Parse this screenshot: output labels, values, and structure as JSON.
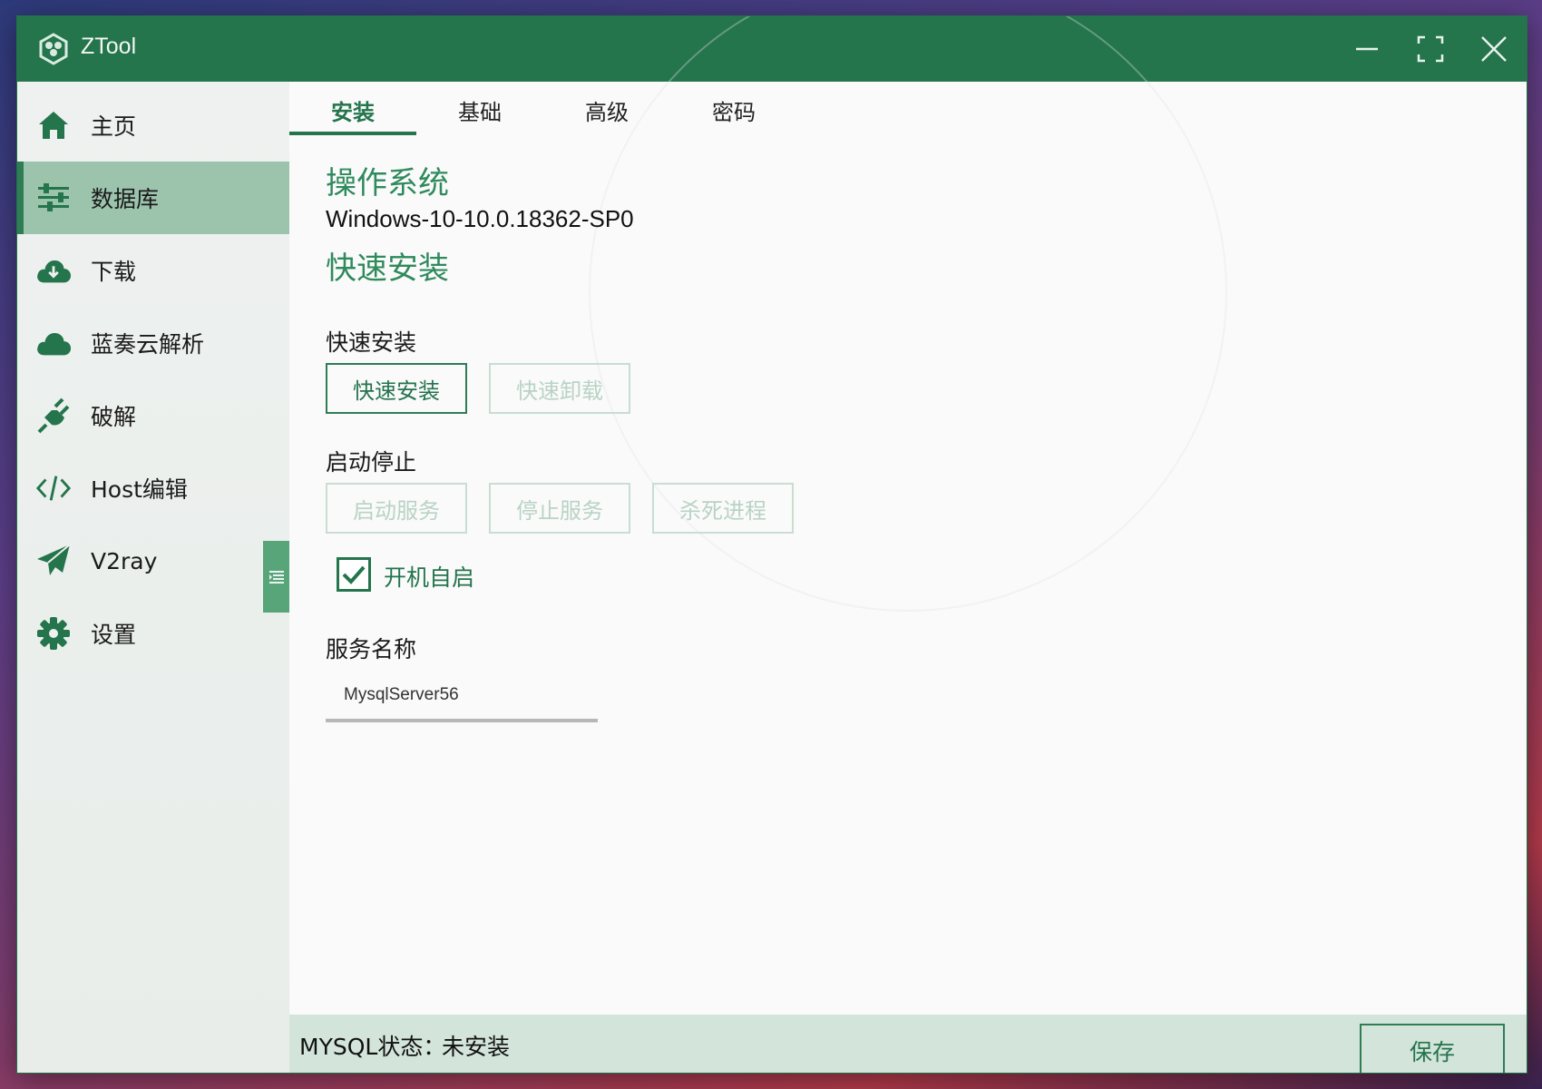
{
  "app": {
    "title": "ZTool"
  },
  "colors": {
    "accent": "#24744c",
    "active_nav_bg": "#9cc4ad",
    "status_bar_bg": "#d3e4da",
    "disabled_text": "#b9d3c4"
  },
  "sidebar": {
    "items": [
      {
        "label": "主页",
        "icon": "home-icon",
        "active": false
      },
      {
        "label": "数据库",
        "icon": "sliders-icon",
        "active": true
      },
      {
        "label": "下载",
        "icon": "cloud-download-icon",
        "active": false
      },
      {
        "label": "蓝奏云解析",
        "icon": "cloud-icon",
        "active": false
      },
      {
        "label": "破解",
        "icon": "plug-icon",
        "active": false
      },
      {
        "label": "Host编辑",
        "icon": "code-icon",
        "active": false
      },
      {
        "label": "V2ray",
        "icon": "paper-plane-icon",
        "active": false
      },
      {
        "label": "设置",
        "icon": "gear-icon",
        "active": false
      }
    ]
  },
  "tabs": [
    {
      "label": "安装",
      "active": true
    },
    {
      "label": "基础",
      "active": false
    },
    {
      "label": "高级",
      "active": false
    },
    {
      "label": "密码",
      "active": false
    }
  ],
  "main": {
    "os_title": "操作系统",
    "os_value": "Windows-10-10.0.18362-SP0",
    "quick_title": "快速安装",
    "quick_group_label": "快速安装",
    "install_button": "快速安装",
    "uninstall_button": "快速卸载",
    "start_stop_label": "启动停止",
    "start_service_button": "启动服务",
    "stop_service_button": "停止服务",
    "kill_process_button": "杀死进程",
    "autostart_label": "开机自启",
    "autostart_checked": true,
    "service_name_label": "服务名称",
    "service_name_value": "MysqlServer56"
  },
  "status": {
    "label": "MYSQL状态：",
    "value": "未安装",
    "save_button": "保存"
  }
}
